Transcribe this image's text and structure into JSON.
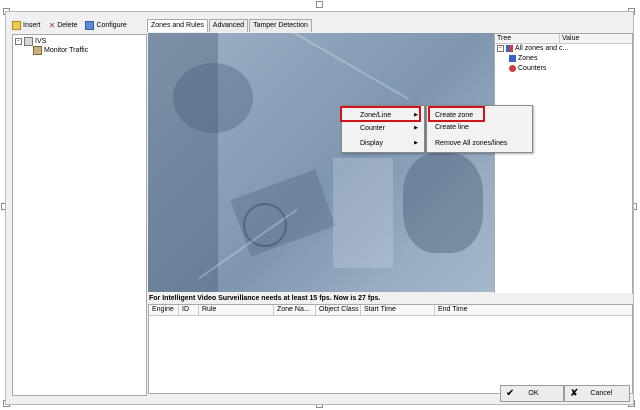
{
  "toolbar": {
    "insert": "Insert",
    "delete": "Delete",
    "configure": "Configure"
  },
  "tree": {
    "root": "IVS",
    "child": "Monitor Traffic"
  },
  "tabs": [
    "Zones and Rules",
    "Advanced",
    "Tamper Detection"
  ],
  "props": {
    "col_tree": "Tree",
    "col_value": "Value",
    "items": [
      "All zones and c...",
      "Zones",
      "Counters"
    ]
  },
  "status_text": "For Intelligent Video Surveillance needs at least 15 fps. Now is 27 fps.",
  "events_columns": [
    "Engine",
    "ID",
    "Rule",
    "Zone Na...",
    "Object Class",
    "Start Time",
    "End Time"
  ],
  "context_menu": {
    "items": [
      "Zone/Line",
      "Counter",
      "Display"
    ]
  },
  "submenu": {
    "items": [
      "Create zone",
      "Create line",
      "Remove All zones/lines"
    ]
  },
  "buttons": {
    "ok": "OK",
    "cancel": "Cancel"
  },
  "colors": {
    "highlight": "#d0141e",
    "video_tint": "#8aa0b8"
  }
}
